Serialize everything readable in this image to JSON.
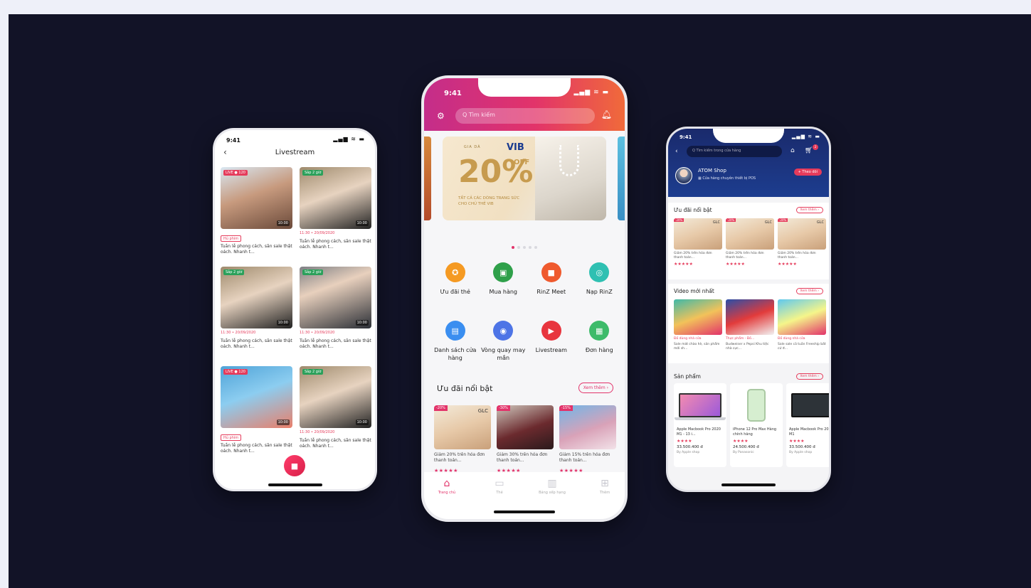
{
  "left_phone": {
    "time": "9:41",
    "status_icons": "▂▄▆ ≋ ▬",
    "title": "Livestream",
    "back_icon": "‹",
    "streams": [
      {
        "badge": "LIVE ● 120",
        "badge_color": "#e53b5b",
        "duration": "10:00",
        "tag": "Hủ phim",
        "date": "",
        "desc": "Tuần lễ phong cách, săn sale thật oách. Nhanh t..."
      },
      {
        "badge": "Sắp 2 giờ",
        "badge_color": "#2aa05a",
        "duration": "10:00",
        "tag": "",
        "date": "11:30 • 20/09/2020",
        "desc": "Tuần lễ phong cách, săn sale thật oách. Nhanh t..."
      },
      {
        "badge": "Sắp 2 giờ",
        "badge_color": "#2aa05a",
        "duration": "10:00",
        "tag": "",
        "date": "11:30 • 20/09/2020",
        "desc": "Tuần lễ phong cách, săn sale thật oách. Nhanh t..."
      },
      {
        "badge": "Sắp 2 giờ",
        "badge_color": "#2aa05a",
        "duration": "10:00",
        "tag": "",
        "date": "11:30 • 20/09/2020",
        "desc": "Tuần lễ phong cách, săn sale thật oách. Nhanh t..."
      },
      {
        "badge": "LIVE ● 120",
        "badge_color": "#e53b5b",
        "duration": "10:00",
        "tag": "Hủ phim",
        "date": "",
        "desc": "Tuần lễ phong cách, săn sale thật oách. Nhanh t..."
      },
      {
        "badge": "Sắp 2 giờ",
        "badge_color": "#2aa05a",
        "duration": "10:00",
        "tag": "",
        "date": "11:30 • 20/09/2020",
        "desc": "Tuần lễ phong cách, săn sale thật oách. Nhanh t..."
      }
    ],
    "fab_icon": "video-camera-icon"
  },
  "center_phone": {
    "time": "9:41",
    "status_icons": "▂▄▆ ≋ ▬",
    "search_placeholder": "Q Tìm kiếm",
    "banner": {
      "logo": "GIA DÁ",
      "bank": "VIB",
      "percent": "20%",
      "off": "OFF",
      "line1": "TẤT CẢ CÁC DÒNG TRANG SỨC",
      "line2": "CHO CHỦ THẺ VIB"
    },
    "menu": [
      {
        "label": "Ưu đãi thẻ",
        "color": "#f59a23",
        "icon": "✪"
      },
      {
        "label": "Mua hàng",
        "color": "#2fa04a",
        "icon": "▣"
      },
      {
        "label": "RinZ Meet",
        "color": "#ef5a2e",
        "icon": "■"
      },
      {
        "label": "Nạp RinZ",
        "color": "#2fc0b2",
        "icon": "◎"
      },
      {
        "label": "Danh sách cửa hàng",
        "color": "#3a8ef0",
        "icon": "▤"
      },
      {
        "label": "Vòng quay may mắn",
        "color": "#4d74e6",
        "icon": "◉"
      },
      {
        "label": "Livestream",
        "color": "#e8353e",
        "icon": "▶"
      },
      {
        "label": "Đơn hàng",
        "color": "#3dbb6a",
        "icon": "▦"
      }
    ],
    "section_title": "Ưu đãi nổi bật",
    "section_more": "Xem thêm ›",
    "deals": [
      {
        "badge": "-20%",
        "brand": "GLC",
        "desc": "Giảm 20% trên hóa đơn thanh toán...",
        "stars": "★★★★★"
      },
      {
        "badge": "-30%",
        "brand": "",
        "desc": "Giảm 30% trên hóa đơn thanh toán...",
        "stars": "★★★★★"
      },
      {
        "badge": "-15%",
        "brand": "",
        "desc": "Giảm 15% trên hóa đơn thanh toán...",
        "stars": "★★★★★"
      }
    ],
    "tabs": [
      {
        "label": "Trang chủ",
        "icon": "⌂"
      },
      {
        "label": "Thẻ",
        "icon": "▭"
      },
      {
        "label": "Bảng xếp hạng",
        "icon": "▥"
      },
      {
        "label": "Thêm",
        "icon": "⊞"
      }
    ]
  },
  "right_phone": {
    "time": "9:41",
    "status_icons": "▂▄▆ ≋ ▬",
    "search_placeholder": "Q Tìm kiếm trong cửa hàng",
    "cart_count": "2",
    "shop_name": "ATOM Shop",
    "shop_sub": "▦ Cửa hàng chuyên thiết bị POS",
    "follow_label": "+ Theo dõi",
    "sec1_title": "Ưu đãi nổi bật",
    "sec2_title": "Video mới nhất",
    "sec3_title": "Sản phẩm",
    "more_label": "Xem thêm ›",
    "deals": [
      {
        "badge": "-20%",
        "brand": "GLC",
        "desc": "Giảm 20% trên hóa đơn thanh toán...",
        "stars": "★★★★★"
      },
      {
        "badge": "-20%",
        "brand": "GLC",
        "desc": "Giảm 20% trên hóa đơn thanh toán...",
        "stars": "★★★★★"
      },
      {
        "badge": "-20%",
        "brand": "GLC",
        "desc": "Giảm 20% trên hóa đơn thanh toán...",
        "stars": "★★★★★"
      }
    ],
    "videos": [
      {
        "cat": "Đồ dùng nhà cửa",
        "desc": "Sale mát chào hè, sản phẩm mới sh..."
      },
      {
        "cat": "Thực phẩm - Đồ...",
        "desc": "Budweiser x Pepsi Khu tiệc nhà cực..."
      },
      {
        "cat": "Đồ dùng nhà cửa",
        "desc": "Sale sale cả tuần Freeship bất cứ đ..."
      }
    ],
    "products": [
      {
        "name": "Apple Macbook Pro 2020 M1 - 13 i...",
        "stars": "★★★★",
        "price": "33.500.400 đ",
        "seller": "By Apple shop"
      },
      {
        "name": "iPhone 12 Pro Max Hàng chính hãng",
        "stars": "★★★★",
        "price": "24.500.400 đ",
        "seller": "By Panasonic"
      },
      {
        "name": "Apple Macbook Pro 2020 M1",
        "stars": "★★★★",
        "price": "33.500.400 đ",
        "seller": "By Apple shop"
      }
    ]
  }
}
